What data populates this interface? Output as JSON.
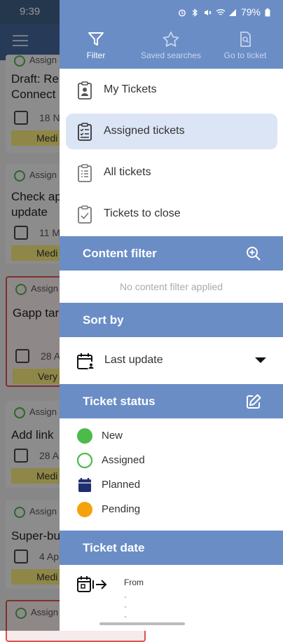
{
  "status_bar": {
    "time": "9:39",
    "battery": "79%"
  },
  "tabs": [
    {
      "label": "Filter",
      "icon": "filter-icon",
      "active": true
    },
    {
      "label": "Saved searches",
      "icon": "star-icon",
      "active": false
    },
    {
      "label": "Go to ticket",
      "icon": "ticket-search-icon",
      "active": false
    }
  ],
  "menu": [
    {
      "label": "My Tickets",
      "icon": "badge-clipboard-icon",
      "selected": false
    },
    {
      "label": "Assigned tickets",
      "icon": "checklist-clipboard-icon",
      "selected": true
    },
    {
      "label": "All tickets",
      "icon": "list-clipboard-icon",
      "selected": false
    },
    {
      "label": "Tickets to close",
      "icon": "check-clipboard-icon",
      "selected": false
    }
  ],
  "content_filter": {
    "title": "Content filter",
    "empty": "No content filter applied"
  },
  "sort": {
    "title": "Sort by",
    "value": "Last update"
  },
  "ticket_status": {
    "title": "Ticket status",
    "items": [
      {
        "label": "New",
        "color": "#4cbb4c",
        "style": "filled-circle"
      },
      {
        "label": "Assigned",
        "color": "#4cbb4c",
        "style": "ring"
      },
      {
        "label": "Planned",
        "color": "#1f2e6e",
        "style": "calendar"
      },
      {
        "label": "Pending",
        "color": "#f5a20a",
        "style": "filled-circle"
      }
    ]
  },
  "ticket_date": {
    "title": "Ticket date",
    "from_label": "From",
    "from_value": "- - -"
  },
  "background": {
    "cards": [
      {
        "assign": "Assign",
        "title1": "Draft: Re",
        "title2": "Connect",
        "date": "18 N",
        "prio": "Medi"
      },
      {
        "assign": "Assign",
        "title1": "Check ap",
        "title2": "update",
        "date": "11 M",
        "prio": "Medi"
      },
      {
        "assign": "Assign",
        "title1": "Gapp tar",
        "title2": "",
        "date": "28 A",
        "prio": "Very"
      },
      {
        "assign": "Assign",
        "title1": "Add link",
        "title2": "",
        "date": "28 A",
        "prio": "Medi"
      },
      {
        "assign": "Assign",
        "title1": "Super-bu",
        "title2": "",
        "date": "4 Ap",
        "prio": "Medi"
      },
      {
        "assign": "Assign",
        "title1": "",
        "title2": "",
        "date": "",
        "prio": ""
      }
    ]
  }
}
